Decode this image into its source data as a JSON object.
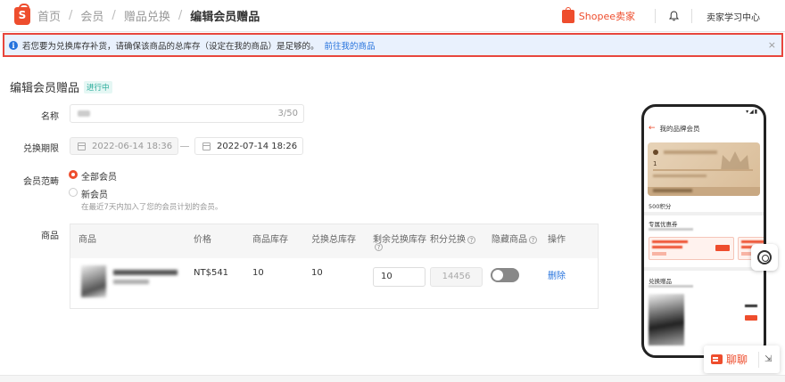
{
  "breadcrumb": {
    "items": [
      "首页",
      "会员",
      "赠品兑换"
    ],
    "current": "编辑会员赠品",
    "separator": "/"
  },
  "header": {
    "brand": "Shopee卖家",
    "study": "卖家学习中心"
  },
  "notice": {
    "message": "若您要为兑换库存补货，请确保该商品的总库存（设定在我的商品）是足够的。",
    "link": "前往我的商品",
    "close": "×"
  },
  "page": {
    "title": "编辑会员赠品",
    "status": "进行中"
  },
  "form": {
    "name_label": "名称",
    "name_count": "3/50",
    "period_label": "兑换期限",
    "start_date": "2022-06-14 18:36",
    "end_date": "2022-07-14 18:26",
    "scope_label": "会员范畴",
    "scope_all": "全部会员",
    "scope_new": "新会员",
    "scope_new_hint": "在最近7天内加入了您的会员计划的会员。",
    "product_label": "商品"
  },
  "table": {
    "headers": {
      "product": "商品",
      "price": "价格",
      "product_stock": "商品库存",
      "exchange_total_stock": "兑换总库存",
      "remaining_stock": "剩余兑换库存",
      "points": "积分兑换",
      "hide_product": "隐藏商品",
      "action": "操作"
    },
    "row": {
      "price": "NT$541",
      "product_stock": "10",
      "exchange_total_stock": "10",
      "remaining_stock": "10",
      "points": "14456",
      "hidden": false,
      "delete": "删除"
    }
  },
  "phone_preview": {
    "title": "我的品牌会员",
    "level": "1",
    "points": "500积分",
    "vouchers_title": "专属优惠券",
    "gifts_title": "兑换赠品"
  },
  "chat": {
    "label": "聊聊"
  },
  "colors": {
    "brand": "#ee4d2d",
    "link": "#2673dd",
    "notice_bg": "#e9f1fd",
    "highlight_border": "#e8463c",
    "status_green": "#26aa99"
  },
  "icons": [
    "shopee-logo-icon",
    "bell-icon",
    "info-icon",
    "close-icon",
    "calendar-icon",
    "question-icon",
    "back-arrow-icon",
    "crown-icon",
    "headset-icon",
    "chat-icon",
    "expand-icon"
  ]
}
